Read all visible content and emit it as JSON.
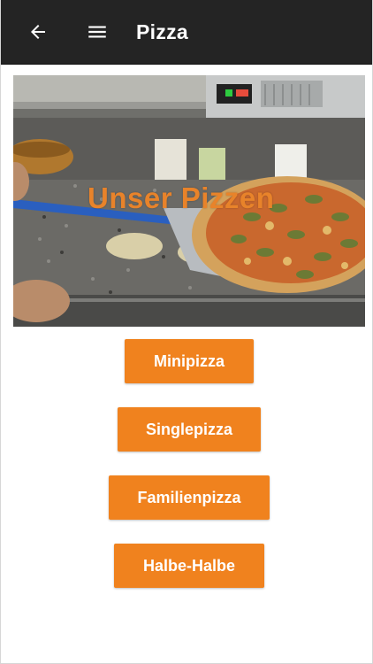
{
  "toolbar": {
    "title": "Pizza",
    "back_icon": "arrow-left-icon",
    "menu_icon": "hamburger-menu-icon",
    "background": "#242424"
  },
  "hero": {
    "caption": "Unser Pizzen",
    "caption_color": "#e8832a"
  },
  "menu_buttons": [
    {
      "label": "Minipizza"
    },
    {
      "label": "Singlepizza"
    },
    {
      "label": "Familienpizza"
    },
    {
      "label": "Halbe-Halbe"
    }
  ],
  "colors": {
    "accent": "#f0821e",
    "button_text": "#ffffff"
  }
}
